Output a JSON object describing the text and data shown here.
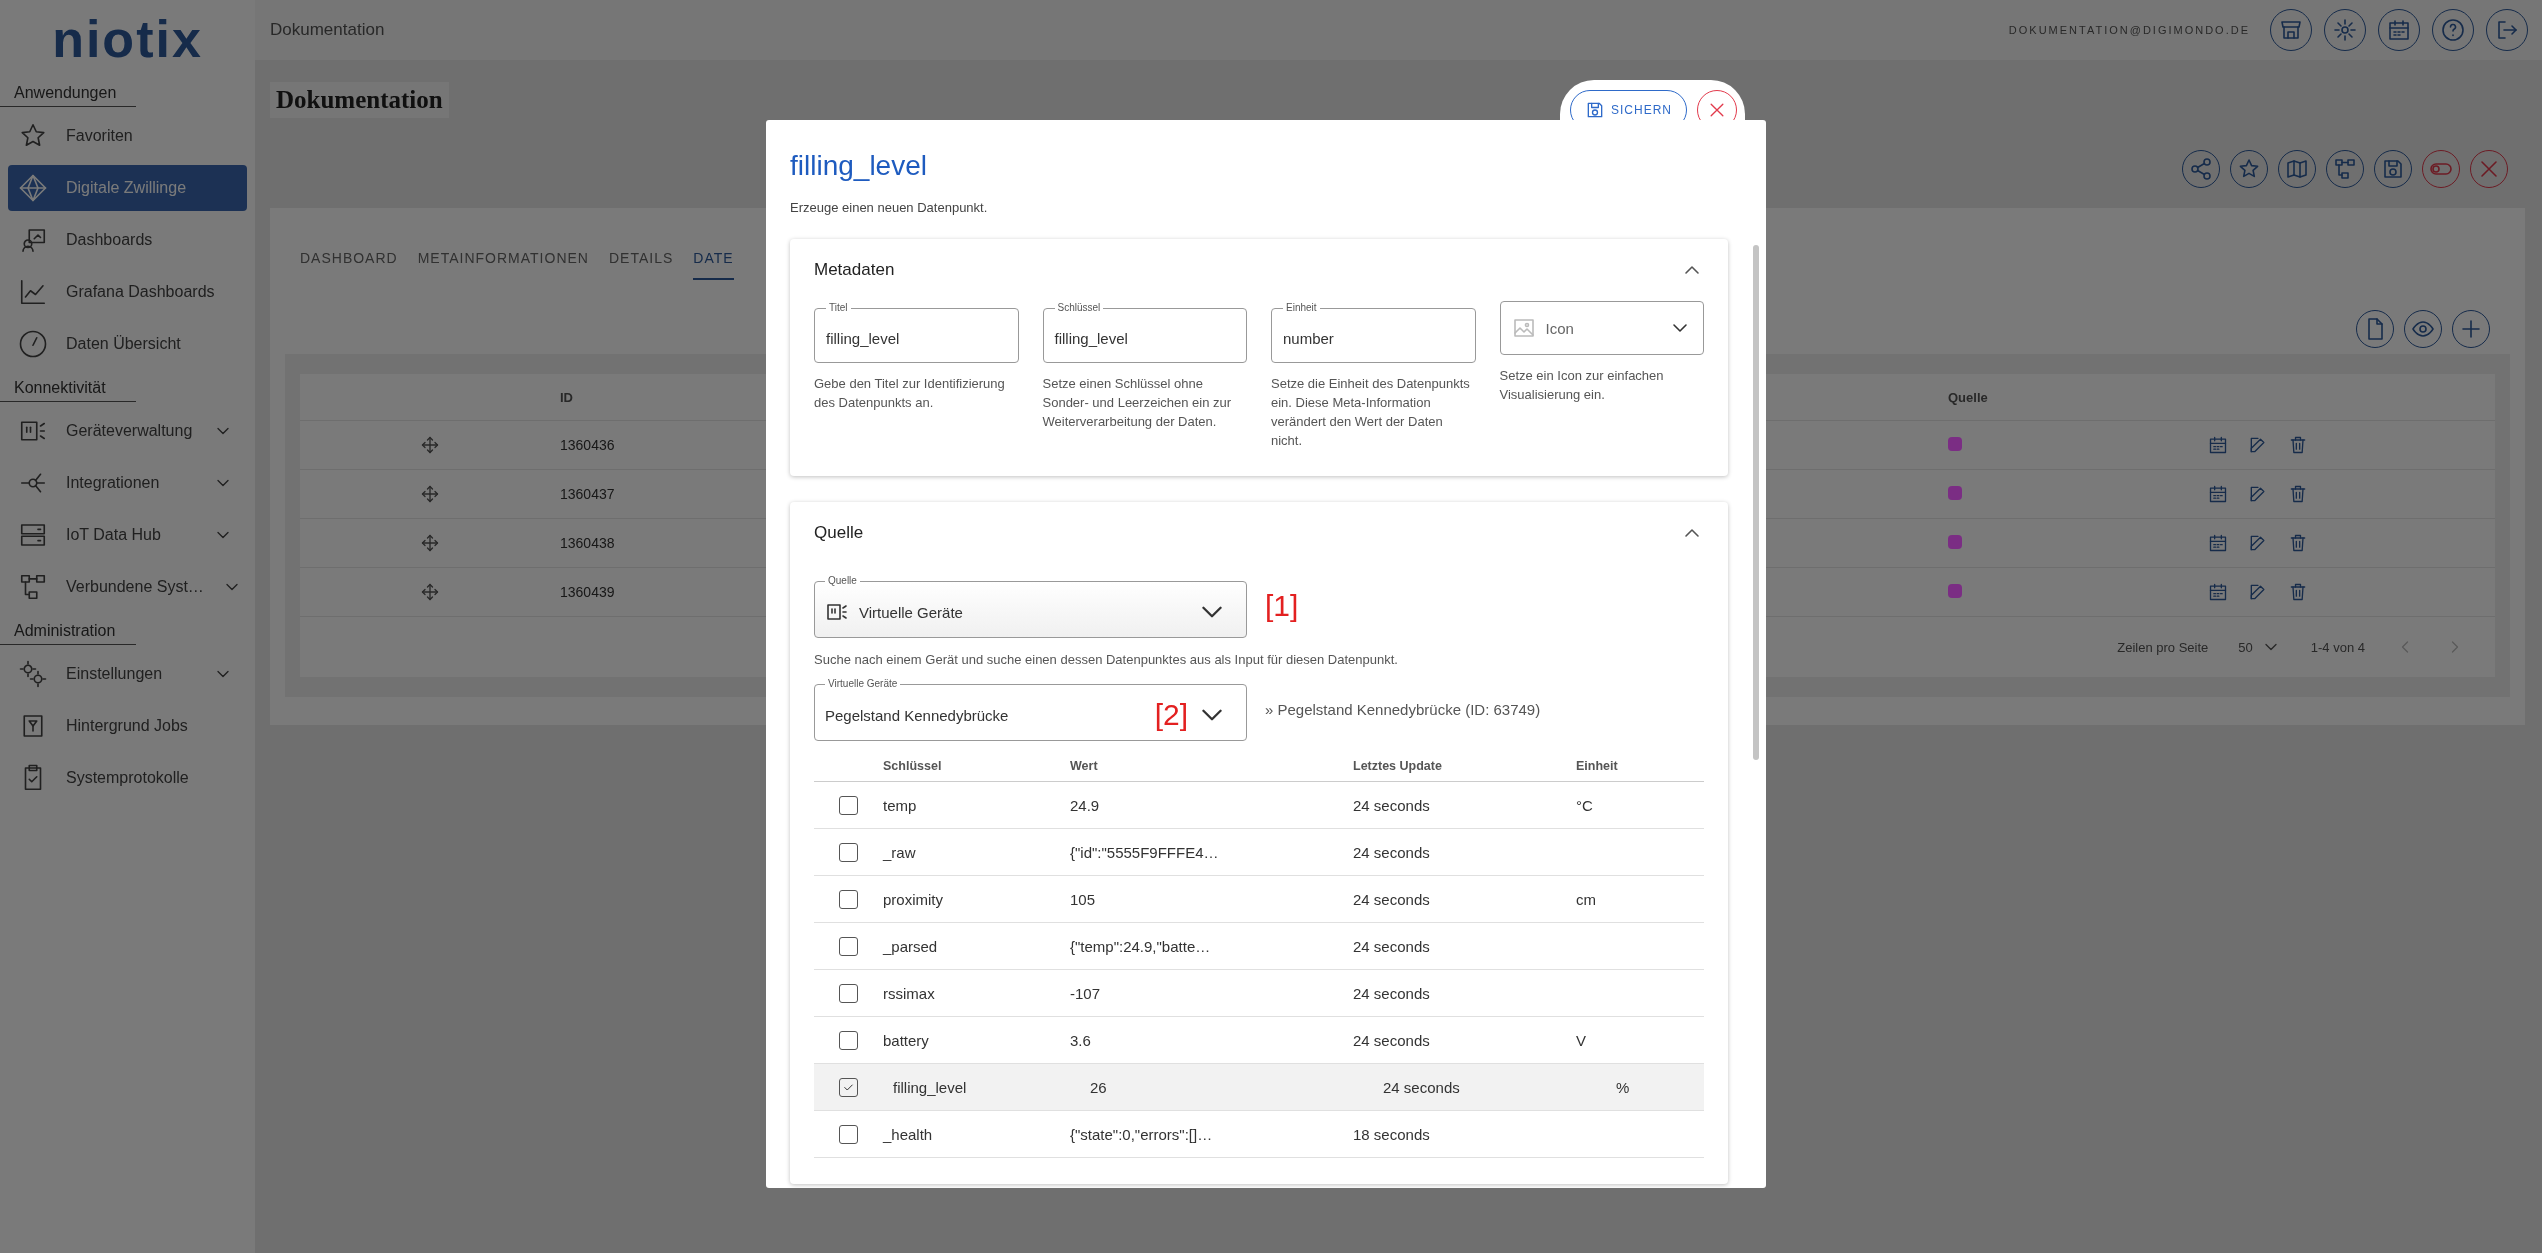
{
  "header": {
    "logo": "niotix",
    "breadcrumb": "Dokumentation",
    "user": "DOKUMENTATION@DIGIMONDO.DE"
  },
  "sidebar": {
    "sections": [
      {
        "title": "Anwendungen",
        "items": [
          {
            "label": "Favoriten",
            "selected": false,
            "expandable": false
          },
          {
            "label": "Digitale Zwillinge",
            "selected": true,
            "expandable": false
          },
          {
            "label": "Dashboards",
            "selected": false,
            "expandable": false
          },
          {
            "label": "Grafana Dashboards",
            "selected": false,
            "expandable": false
          },
          {
            "label": "Daten Übersicht",
            "selected": false,
            "expandable": false
          }
        ]
      },
      {
        "title": "Konnektivität",
        "items": [
          {
            "label": "Geräteverwaltung",
            "selected": false,
            "expandable": true
          },
          {
            "label": "Integrationen",
            "selected": false,
            "expandable": true
          },
          {
            "label": "IoT Data Hub",
            "selected": false,
            "expandable": true
          },
          {
            "label": "Verbundene Syst…",
            "selected": false,
            "expandable": true
          }
        ]
      },
      {
        "title": "Administration",
        "items": [
          {
            "label": "Einstellungen",
            "selected": false,
            "expandable": true
          },
          {
            "label": "Hintergrund Jobs",
            "selected": false,
            "expandable": false
          },
          {
            "label": "Systemprotokolle",
            "selected": false,
            "expandable": false
          }
        ]
      }
    ]
  },
  "page": {
    "title": "Dokumentation",
    "tabs": [
      {
        "label": "DASHBOARD",
        "selected": false
      },
      {
        "label": "METAINFORMATIONEN",
        "selected": false
      },
      {
        "label": "DETAILS",
        "selected": false
      },
      {
        "label": "DATE",
        "selected": true
      }
    ],
    "table": {
      "columns": [
        "ID",
        "Quelle"
      ],
      "rows": [
        {
          "id": "1360436",
          "color": "#7b2d84"
        },
        {
          "id": "1360437",
          "color": "#7b2d84"
        },
        {
          "id": "1360438",
          "color": "#7b2d84"
        },
        {
          "id": "1360439",
          "color": "#7b2d84"
        }
      ]
    },
    "pagination": {
      "label": "Zeilen pro Seite",
      "per_page": "50",
      "range": "1-4 von 4"
    }
  },
  "dialog": {
    "title": "filling_level",
    "subtitle": "Erzeuge einen neuen Datenpunkt.",
    "save_button": "SICHERN",
    "metadata": {
      "title": "Metadaten",
      "expanded": true,
      "fields": [
        {
          "kind": "text",
          "label": "Titel",
          "value": "filling_level",
          "help": "Gebe den Titel zur Identifizierung des Datenpunkts an."
        },
        {
          "kind": "text",
          "label": "Schlüssel",
          "value": "filling_level",
          "help": "Setze einen Schlüssel ohne Sonder- und Leerzeichen ein zur Weiterverarbeitung der Daten."
        },
        {
          "kind": "text",
          "label": "Einheit",
          "value": "number",
          "help": "Setze die Einheit des Datenpunkts ein. Diese Meta-Information verändert den Wert der Daten nicht."
        },
        {
          "kind": "select",
          "placeholder": "Icon",
          "help": "Setze ein Icon zur einfachen Visualisierung ein."
        }
      ]
    },
    "source": {
      "title": "Quelle",
      "expanded": true,
      "source_select": {
        "label": "Quelle",
        "value": "Virtuelle Geräte",
        "annotation": "[1]"
      },
      "hint": "Suche nach einem Gerät und suche einen dessen Datenpunktes aus als Input für diesen Datenpunkt.",
      "device_select": {
        "label": "Virtuelle Geräte",
        "value": "Pegelstand Kennedybrücke",
        "annotation": "[2]"
      },
      "device_link": "» Pegelstand Kennedybrücke (ID: 63749)",
      "table": {
        "columns": [
          "Schlüssel",
          "Wert",
          "Letztes Update",
          "Einheit"
        ],
        "rows": [
          {
            "checked": false,
            "key": "temp",
            "value": "24.9",
            "updated": "24 seconds",
            "unit": "°C"
          },
          {
            "checked": false,
            "key": "_raw",
            "value": "{\"id\":\"5555F9FFFE4…",
            "updated": "24 seconds"
          },
          {
            "checked": false,
            "key": "proximity",
            "value": "105",
            "updated": "24 seconds",
            "unit": "cm"
          },
          {
            "checked": false,
            "key": "_parsed",
            "value": "{\"temp\":24.9,\"batte…",
            "updated": "24 seconds"
          },
          {
            "checked": false,
            "key": "rssimax",
            "value": "-107",
            "updated": "24 seconds"
          },
          {
            "checked": false,
            "key": "battery",
            "value": "3.6",
            "updated": "24 seconds",
            "unit": "V"
          },
          {
            "checked": true,
            "key": "filling_level",
            "value": "26",
            "updated": "24 seconds",
            "unit": "%"
          },
          {
            "checked": false,
            "key": "_health",
            "value": "{\"state\":0,\"errors\":[]…",
            "updated": "18 seconds"
          }
        ]
      }
    }
  }
}
